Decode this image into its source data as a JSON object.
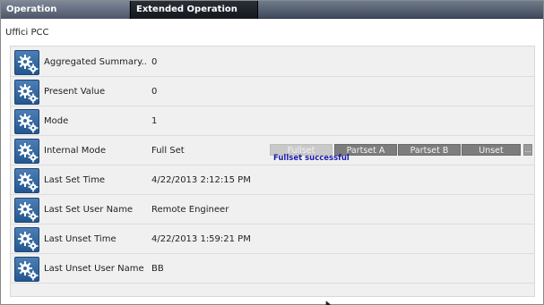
{
  "tabs": [
    {
      "label": "Operation"
    },
    {
      "label": "Extended Operation"
    }
  ],
  "section_title": "Uffici PCC",
  "rows": [
    {
      "label": "Aggregated Summary...",
      "value": "0"
    },
    {
      "label": "Present Value",
      "value": "0"
    },
    {
      "label": "Mode",
      "value": "1"
    },
    {
      "label": "Internal Mode",
      "value": "Full Set"
    },
    {
      "label": "Last Set Time",
      "value": "4/22/2013 2:12:15 PM"
    },
    {
      "label": "Last Set User Name",
      "value": "Remote Engineer"
    },
    {
      "label": "Last Unset Time",
      "value": "4/22/2013 1:59:21 PM"
    },
    {
      "label": "Last Unset User Name",
      "value": "BB"
    }
  ],
  "mode_buttons": {
    "fullset": "Fullset",
    "partset_a": "Partset A",
    "partset_b": "Partset B",
    "unset": "Unset",
    "more": "..."
  },
  "status_message": "Fullset successful",
  "colors": {
    "accent_blue": "#1a1aa8",
    "gear_blue": "#2f6aa6",
    "tab_active_bg": "#1b1f26"
  },
  "icons": {
    "row_icon": "gears-icon"
  }
}
